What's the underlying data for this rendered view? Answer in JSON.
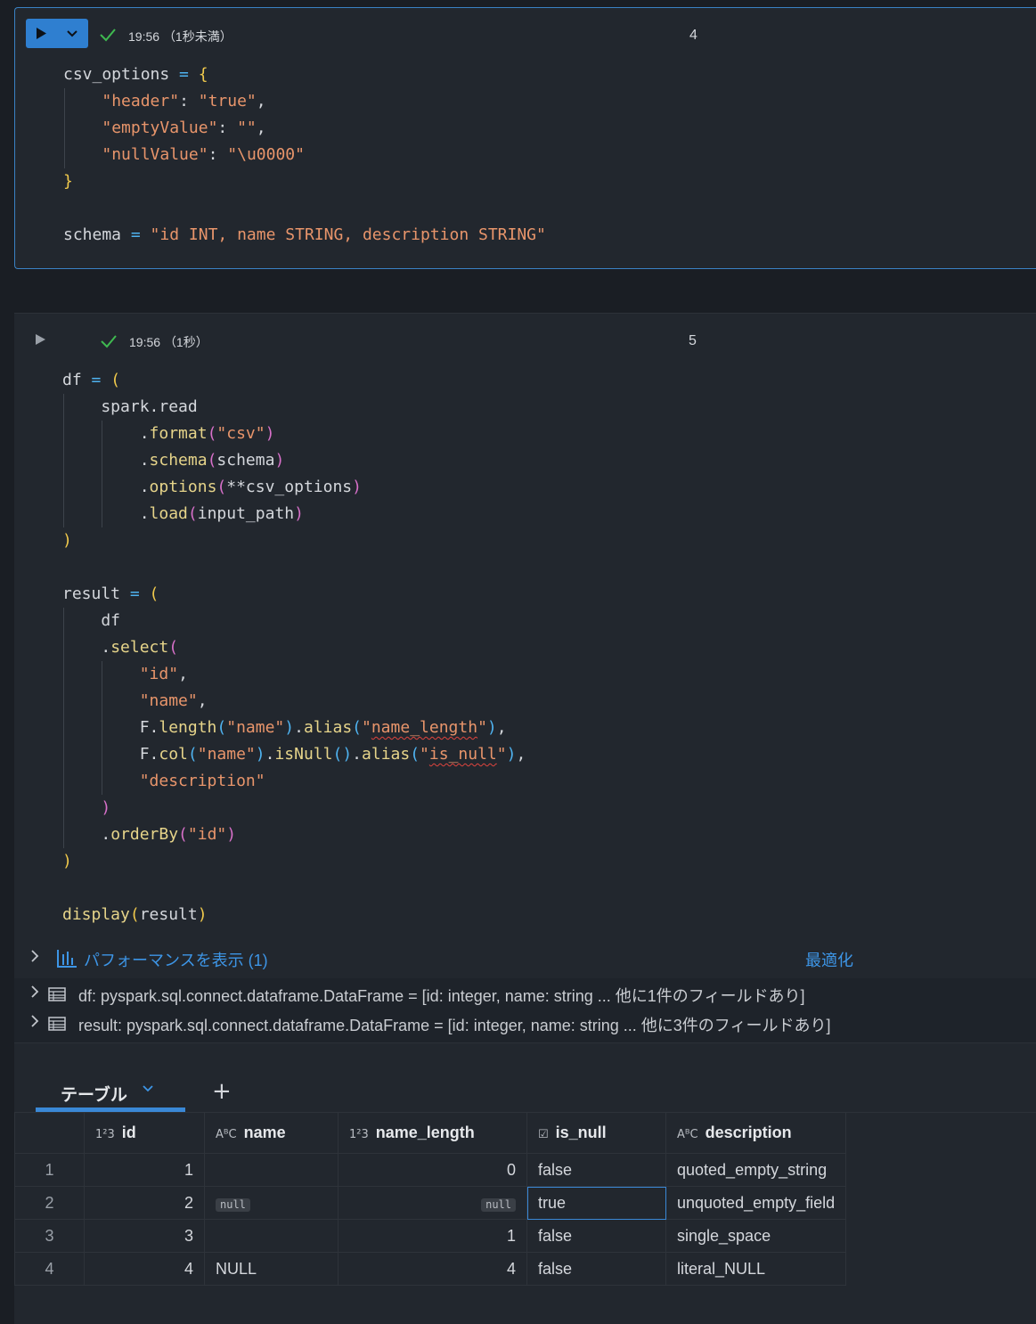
{
  "cell4": {
    "time": "19:56",
    "duration": "（1秒未満）",
    "number": "4",
    "code": [
      [
        [
          "k",
          "csv_options "
        ],
        [
          "op",
          "="
        ],
        [
          "k",
          " "
        ],
        [
          "y",
          "{"
        ]
      ],
      [
        [
          "k",
          "    "
        ],
        [
          "s",
          "\"header\""
        ],
        [
          "k",
          ": "
        ],
        [
          "s",
          "\"true\""
        ],
        [
          "k",
          ","
        ]
      ],
      [
        [
          "k",
          "    "
        ],
        [
          "s",
          "\"emptyValue\""
        ],
        [
          "k",
          ": "
        ],
        [
          "s",
          "\"\""
        ],
        [
          "k",
          ","
        ]
      ],
      [
        [
          "k",
          "    "
        ],
        [
          "s",
          "\"nullValue\""
        ],
        [
          "k",
          ": "
        ],
        [
          "s",
          "\"\\u0000\""
        ]
      ],
      [
        [
          "y",
          "}"
        ]
      ],
      [
        [
          "k",
          ""
        ]
      ],
      [
        [
          "k",
          "schema "
        ],
        [
          "op",
          "="
        ],
        [
          "k",
          " "
        ],
        [
          "s",
          "\"id INT, name STRING, description STRING\""
        ]
      ]
    ]
  },
  "cell5": {
    "time": "19:56",
    "duration": "（1秒）",
    "number": "5",
    "code": [
      [
        [
          "k",
          "df "
        ],
        [
          "op",
          "="
        ],
        [
          "k",
          " "
        ],
        [
          "y",
          "("
        ]
      ],
      [
        [
          "k",
          "    spark.read"
        ]
      ],
      [
        [
          "k",
          "        ."
        ],
        [
          "f",
          "format"
        ],
        [
          "p",
          "("
        ],
        [
          "s",
          "\"csv\""
        ],
        [
          "p",
          ")"
        ]
      ],
      [
        [
          "k",
          "        ."
        ],
        [
          "f",
          "schema"
        ],
        [
          "p",
          "("
        ],
        [
          "k",
          "schema"
        ],
        [
          "p",
          ")"
        ]
      ],
      [
        [
          "k",
          "        ."
        ],
        [
          "f",
          "options"
        ],
        [
          "p",
          "("
        ],
        [
          "k",
          "**csv_options"
        ],
        [
          "p",
          ")"
        ]
      ],
      [
        [
          "k",
          "        ."
        ],
        [
          "f",
          "load"
        ],
        [
          "p",
          "("
        ],
        [
          "k",
          "input_path"
        ],
        [
          "p",
          ")"
        ]
      ],
      [
        [
          "y",
          ")"
        ]
      ],
      [
        [
          "k",
          ""
        ]
      ],
      [
        [
          "k",
          "result "
        ],
        [
          "op",
          "="
        ],
        [
          "k",
          " "
        ],
        [
          "y",
          "("
        ]
      ],
      [
        [
          "k",
          "    df"
        ]
      ],
      [
        [
          "k",
          "    ."
        ],
        [
          "f",
          "select"
        ],
        [
          "p",
          "("
        ]
      ],
      [
        [
          "k",
          "        "
        ],
        [
          "s",
          "\"id\""
        ],
        [
          "k",
          ","
        ]
      ],
      [
        [
          "k",
          "        "
        ],
        [
          "s",
          "\"name\""
        ],
        [
          "k",
          ","
        ]
      ],
      [
        [
          "k",
          "        F."
        ],
        [
          "f",
          "length"
        ],
        [
          "b",
          "("
        ],
        [
          "s",
          "\"name\""
        ],
        [
          "b",
          ")"
        ],
        [
          "k",
          "."
        ],
        [
          "f",
          "alias"
        ],
        [
          "b",
          "("
        ],
        [
          "s",
          "\""
        ],
        [
          "sw",
          "name_length"
        ],
        [
          "s",
          "\""
        ],
        [
          "b",
          ")"
        ],
        [
          "k",
          ","
        ]
      ],
      [
        [
          "k",
          "        F."
        ],
        [
          "f",
          "col"
        ],
        [
          "b",
          "("
        ],
        [
          "s",
          "\"name\""
        ],
        [
          "b",
          ")"
        ],
        [
          "k",
          "."
        ],
        [
          "f",
          "isNull"
        ],
        [
          "b",
          "()"
        ],
        [
          "k",
          "."
        ],
        [
          "f",
          "alias"
        ],
        [
          "b",
          "("
        ],
        [
          "s",
          "\""
        ],
        [
          "sw",
          "is_null"
        ],
        [
          "s",
          "\""
        ],
        [
          "b",
          ")"
        ],
        [
          "k",
          ","
        ]
      ],
      [
        [
          "k",
          "        "
        ],
        [
          "s",
          "\"description\""
        ]
      ],
      [
        [
          "p",
          "    )"
        ]
      ],
      [
        [
          "k",
          "    ."
        ],
        [
          "f",
          "orderBy"
        ],
        [
          "p",
          "("
        ],
        [
          "s",
          "\"id\""
        ],
        [
          "p",
          ")"
        ]
      ],
      [
        [
          "y",
          ")"
        ]
      ],
      [
        [
          "k",
          ""
        ]
      ],
      [
        [
          "f",
          "display"
        ],
        [
          "y",
          "("
        ],
        [
          "k",
          "result"
        ],
        [
          "y",
          ")"
        ]
      ]
    ],
    "perf_label": "パフォーマンスを表示 (1)",
    "optimize_label": "最適化",
    "variables": [
      "df:  pyspark.sql.connect.dataframe.DataFrame = [id: integer, name: string ... 他に1件のフィールドあり]",
      "result:  pyspark.sql.connect.dataframe.DataFrame = [id: integer, name: string ... 他に3件のフィールドあり]"
    ],
    "tab_label": "テーブル",
    "add_tab": "+",
    "table": {
      "columns": [
        {
          "type": "1²3",
          "name": "id"
        },
        {
          "type": "AᴮC",
          "name": "name"
        },
        {
          "type": "1²3",
          "name": "name_length"
        },
        {
          "type": "☑",
          "name": "is_null"
        },
        {
          "type": "AᴮC",
          "name": "description"
        }
      ],
      "rows": [
        {
          "n": "1",
          "id": "1",
          "name": "",
          "name_length": "0",
          "is_null": "false",
          "description": "quoted_empty_string"
        },
        {
          "n": "2",
          "id": "2",
          "name": "null",
          "name_length": "null",
          "is_null": "true",
          "description": "unquoted_empty_field"
        },
        {
          "n": "3",
          "id": "3",
          "name": "",
          "name_length": "1",
          "is_null": "false",
          "description": "single_space"
        },
        {
          "n": "4",
          "id": "4",
          "name": "NULL",
          "name_length": "4",
          "is_null": "false",
          "description": "literal_NULL"
        }
      ],
      "null_pill_label": "null"
    }
  },
  "colors": {
    "accent": "#3a88d6",
    "string": "#e8956b",
    "func": "#e6d48a",
    "brace": "#f0c94c",
    "paren": "#d770c9",
    "success": "#3fb950"
  }
}
